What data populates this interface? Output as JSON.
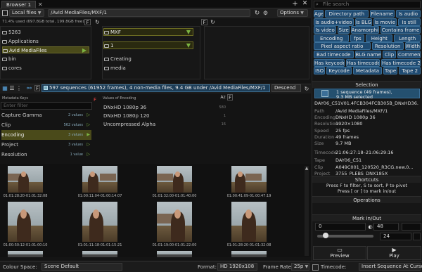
{
  "tab": {
    "label": "Browser 1"
  },
  "toolbar": {
    "drive": "Local files",
    "path": "/Avid MediaFiles/MXF/1",
    "options": "Options"
  },
  "usage": "71.4% used (697.8GB total, 199.8GB free)",
  "col1": [
    "5263",
    "Applications",
    "Avid MediaFiles",
    "bin",
    "cores"
  ],
  "col1_selected": 2,
  "col2": {
    "path1": "MXF",
    "path2": "1",
    "items": [
      "Creating",
      "media"
    ]
  },
  "seqinfo": "597 sequences (61952 frames), 4 non-media files, 9.4 GB under /Avid MediaFiles/MXF/1",
  "descend": "Descend",
  "meta_keys": {
    "header": "Metadata Keys",
    "filter_placeholder": "Enter filter",
    "rows": [
      {
        "label": "Capture Gamma",
        "count": "2 values"
      },
      {
        "label": "Clip",
        "count": "562 values"
      },
      {
        "label": "Encoding",
        "count": "3 values"
      },
      {
        "label": "Project",
        "count": "3 values"
      },
      {
        "label": "Resolution",
        "count": "1 value"
      }
    ],
    "selected": 2
  },
  "meta_values": {
    "header": "Values of Encoding",
    "rows": [
      {
        "label": "DNxHD 1080p 36",
        "n": "580"
      },
      {
        "label": "DNxHD 1080p 120",
        "n": "1"
      },
      {
        "label": "Uncompressed Alpha",
        "n": "16"
      }
    ]
  },
  "timecodes": [
    "01:01:28:20-01:01:32:08",
    "01:00:11:04-01:00:14:07",
    "01:01:32:00-01:01:40:00",
    "01:00:41:09-01:00:47:19",
    "01:00:50:12-01:01:00:10",
    "01:01:11:18-01:01:15:21",
    "01:01:19:00-01:01:22:00",
    "01:01:28:20-01:01:32:08"
  ],
  "bottom": {
    "colour_label": "Colour Space:",
    "colour_value": "Scene Default",
    "format_label": "Format:",
    "format_value": "HD 1920x108",
    "framerate_label": "Frame Rate:",
    "framerate_value": "25p",
    "timecode_label": "Timecode:",
    "timecode_value": "Insert Sequence At Cursor"
  },
  "right": {
    "search_placeholder": "File search",
    "filters": [
      [
        "Age",
        "Directory path",
        "Filename",
        "Is audio"
      ],
      [
        "Is audio+video",
        "Is BLG",
        "Is movie",
        "Is still"
      ],
      [
        "Is video",
        "Size",
        "Anamorphic",
        "Contains frame"
      ],
      [
        "Encoding",
        "fps",
        "Height",
        "Length"
      ],
      [
        "Pixel aspect ratio",
        "Resolution",
        "Width"
      ],
      [
        "Bad timecode",
        "BLG name",
        "Clip",
        "Comment"
      ],
      [
        "Has keycode",
        "Has timecode",
        "Has timecode 2"
      ],
      [
        "ISO",
        "Keycode",
        "Metadata",
        "Tape",
        "Tape 2"
      ]
    ],
    "selection_header": "Selection",
    "selection_line1": "1 sequence (49 frames),",
    "selection_line2": "9.3 MB selected",
    "filename": "DAY06_C51V01.4FCB304FCB305B_DNxHD36.",
    "props": [
      {
        "k": "Path",
        "v": "/Avid MediaFiles/MXF/1"
      },
      {
        "k": "Encoding",
        "v": "DNxHD 1080p 36"
      },
      {
        "k": "Resolution",
        "v": "1920×1080"
      },
      {
        "k": "Speed",
        "v": "25 fps"
      },
      {
        "k": "Duration",
        "v": "49 frames"
      },
      {
        "k": "Size",
        "v": "9.7 MB"
      },
      {
        "k": "Timecode",
        "v": "21:06:27:18–21:06:29:16"
      },
      {
        "k": "Tape",
        "v": "DAY06_C51"
      },
      {
        "k": "Clip",
        "v": "A049C001_120520_R3CG.new.0..."
      },
      {
        "k": "Project",
        "v": "3755_PLEBS_DNX185X"
      }
    ],
    "shortcuts_header": "Shortcuts",
    "shortcuts_line1": "Press F to filter, S to sort, P to pivot",
    "shortcuts_line2": "Press [ or ] to mark in/out",
    "operations_header": "Operations",
    "markio_header": "Mark In/Out",
    "in_value": "0",
    "out_value": "48",
    "length_value": "24",
    "preview": "Preview",
    "play": "Play"
  }
}
